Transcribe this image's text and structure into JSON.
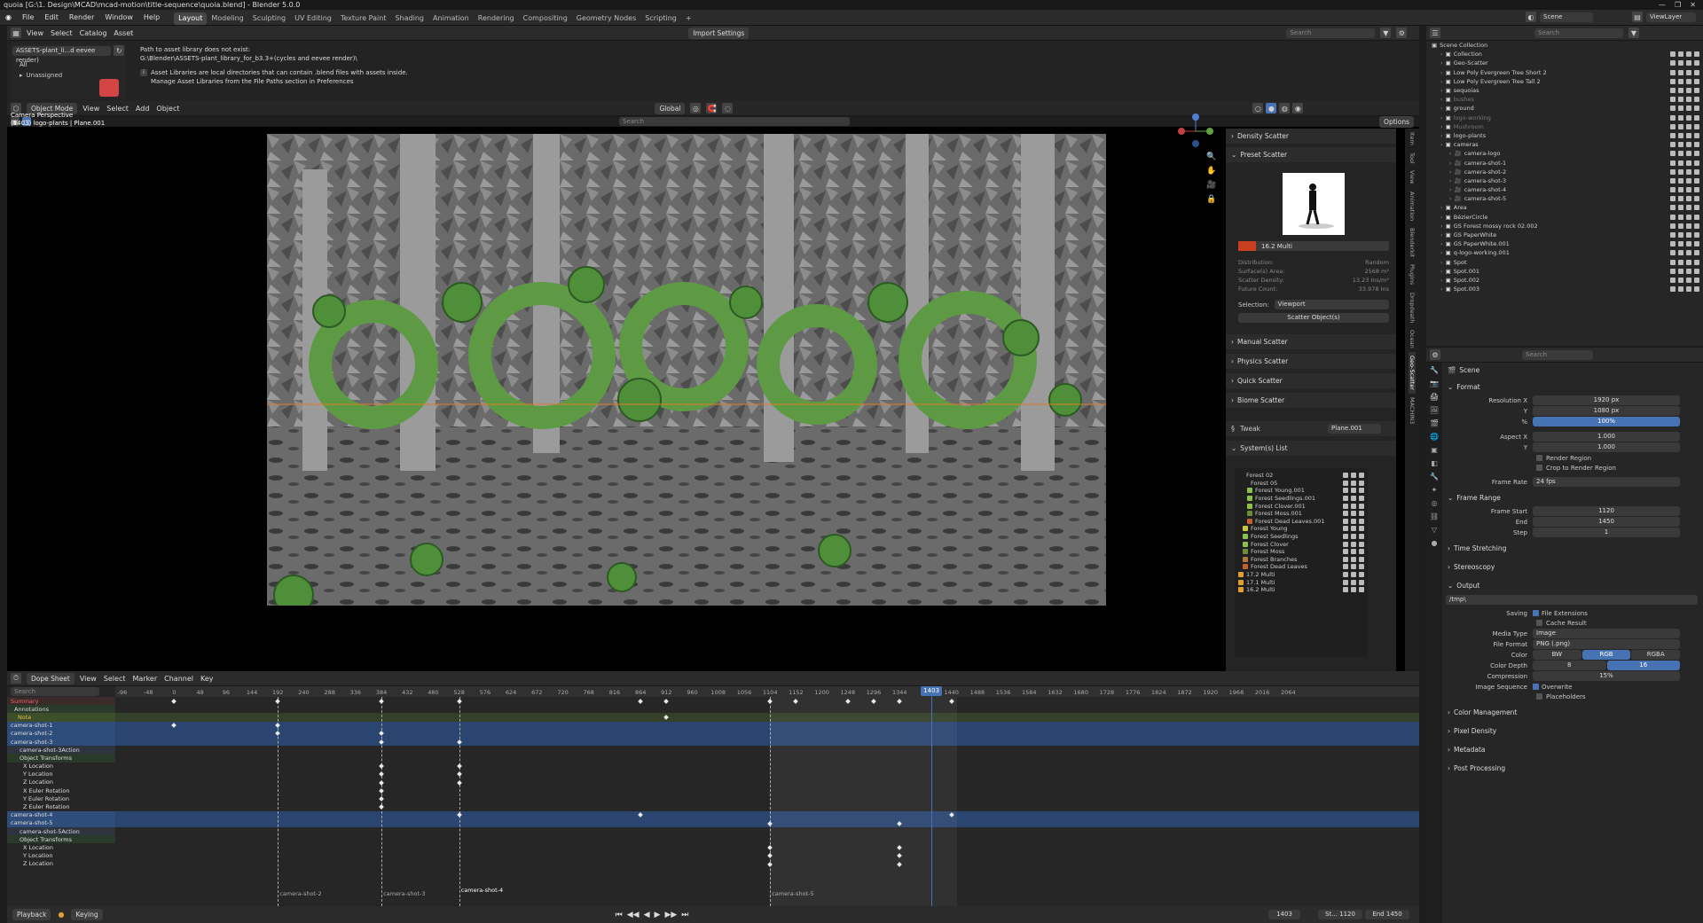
{
  "title_bar": "quoia [G:\\1. Design\\MCAD\\mcad-motion\\title-sequence\\quoia.blend] - Blender 5.0.0",
  "menu": [
    "File",
    "Edit",
    "Render",
    "Window",
    "Help"
  ],
  "workspaces": [
    "Layout",
    "Modeling",
    "Sculpting",
    "UV Editing",
    "Texture Paint",
    "Shading",
    "Animation",
    "Rendering",
    "Compositing",
    "Geometry Nodes",
    "Scripting",
    "+"
  ],
  "active_workspace": "Layout",
  "scene_label": "Scene",
  "viewlayer_label": "ViewLayer",
  "asset_browser": {
    "menus": [
      "View",
      "Select",
      "Catalog",
      "Asset"
    ],
    "import_label": "Import Settings",
    "search_placeholder": "Search",
    "library": "ASSETS-plant_li...d eevee render)",
    "cat_all": "All",
    "cat_unassigned": "Unassigned",
    "error_title": "Path to asset library does not exist:",
    "error_path": "G:\\Blender\\ASSETS-plant_library_for_b3.3+(cycles and eevee render)\\",
    "info_line1": "Asset Libraries are local directories that can contain .blend files with assets inside.",
    "info_line2": "Manage Asset Libraries from the File Paths section in Preferences"
  },
  "viewport": {
    "mode": "Object Mode",
    "menus": [
      "View",
      "Select",
      "Add",
      "Object"
    ],
    "orientation": "Global",
    "options": "Options",
    "search_placeholder": "Search",
    "overlay_title": "Camera Perspective",
    "overlay_sub": "(1403) logo-plants | Plane.001"
  },
  "geo_scatter": {
    "sections_top": [
      "Density Scatter",
      "Preset Scatter"
    ],
    "preset_name": "16.2 Multi",
    "stats": [
      {
        "k": "Distribution:",
        "v": "Random"
      },
      {
        "k": "Surface(s) Area:",
        "v": "2568 m²"
      },
      {
        "k": "Scatter Density:",
        "v": "13.23 Ins/m²"
      },
      {
        "k": "Future Count:",
        "v": "33,978 Ins"
      }
    ],
    "selection_label": "Selection:",
    "selection_value": "Viewport",
    "scatter_btn": "Scatter Object(s)",
    "sections": [
      "Manual Scatter",
      "Physics Scatter",
      "Quick Scatter",
      "Biome Scatter"
    ],
    "tweak": "Tweak",
    "tweak_obj": "Plane.001",
    "systems_label": "System(s) List",
    "systems": [
      {
        "name": "Forest 02",
        "color": "",
        "indent": 0
      },
      {
        "name": "Forest 05",
        "color": "",
        "indent": 1
      },
      {
        "name": "Forest Young.001",
        "color": "#8bc34a",
        "indent": 2
      },
      {
        "name": "Forest Seedlings.001",
        "color": "#8bc34a",
        "indent": 2
      },
      {
        "name": "Forest Clover.001",
        "color": "#8bc34a",
        "indent": 2
      },
      {
        "name": "Forest Moss.001",
        "color": "#6b8e3a",
        "indent": 2
      },
      {
        "name": "Forest Dead Leaves.001",
        "color": "#c0622c",
        "indent": 2
      },
      {
        "name": "Forest Young",
        "color": "#c6c93a",
        "indent": 1
      },
      {
        "name": "Forest Seedlings",
        "color": "#8bc34a",
        "indent": 1
      },
      {
        "name": "Forest Clover",
        "color": "#8bc34a",
        "indent": 1
      },
      {
        "name": "Forest Moss",
        "color": "#6b8e3a",
        "indent": 1
      },
      {
        "name": "Forest Branches",
        "color": "#b07a3a",
        "indent": 1
      },
      {
        "name": "Forest Dead Leaves",
        "color": "#c0622c",
        "indent": 1
      },
      {
        "name": "17.2 Multi",
        "color": "#e0a030",
        "indent": 0
      },
      {
        "name": "17.1 Multi",
        "color": "#e0a030",
        "indent": 0
      },
      {
        "name": "16.2 Multi",
        "color": "#e0a030",
        "indent": 0
      }
    ],
    "tabs": [
      "Item",
      "Tool",
      "View",
      "Animation",
      "Blenderkit",
      "Plugins",
      "Dropdeath",
      "Ocean",
      "Geo-Scatter",
      "MACHIN3"
    ]
  },
  "outliner": {
    "search_placeholder": "Search",
    "root": "Scene Collection",
    "items": [
      {
        "name": "Collection",
        "indent": 1,
        "dim": false
      },
      {
        "name": "Geo-Scatter",
        "indent": 1,
        "dim": false
      },
      {
        "name": "Low Poly Evergreen Tree Short 2",
        "indent": 1,
        "dim": false
      },
      {
        "name": "Low Poly Evergreen Tree Tall 2",
        "indent": 1,
        "dim": false
      },
      {
        "name": "sequoias",
        "indent": 1,
        "dim": false
      },
      {
        "name": "bushes",
        "indent": 1,
        "dim": true
      },
      {
        "name": "ground",
        "indent": 1,
        "dim": false
      },
      {
        "name": "logo-working",
        "indent": 1,
        "dim": true
      },
      {
        "name": "Mushroom",
        "indent": 1,
        "dim": true
      },
      {
        "name": "logo-plants",
        "indent": 1,
        "dim": false
      },
      {
        "name": "cameras",
        "indent": 1,
        "dim": false
      },
      {
        "name": "camera-logo",
        "indent": 2,
        "dim": false
      },
      {
        "name": "camera-shot-1",
        "indent": 2,
        "dim": false
      },
      {
        "name": "camera-shot-2",
        "indent": 2,
        "dim": false
      },
      {
        "name": "camera-shot-3",
        "indent": 2,
        "dim": false
      },
      {
        "name": "camera-shot-4",
        "indent": 2,
        "dim": false
      },
      {
        "name": "camera-shot-5",
        "indent": 2,
        "dim": false
      },
      {
        "name": "Area",
        "indent": 1,
        "dim": false
      },
      {
        "name": "BézierCircle",
        "indent": 1,
        "dim": false
      },
      {
        "name": "GS Forest mossy rock 02.002",
        "indent": 1,
        "dim": false
      },
      {
        "name": "GS PaperWhite",
        "indent": 1,
        "dim": false
      },
      {
        "name": "GS PaperWhite.001",
        "indent": 1,
        "dim": false
      },
      {
        "name": "q-logo-working.001",
        "indent": 1,
        "dim": false
      },
      {
        "name": "Spot",
        "indent": 1,
        "dim": false
      },
      {
        "name": "Spot.001",
        "indent": 1,
        "dim": false
      },
      {
        "name": "Spot.002",
        "indent": 1,
        "dim": false
      },
      {
        "name": "Spot.003",
        "indent": 1,
        "dim": false
      }
    ]
  },
  "properties": {
    "search_placeholder": "Search",
    "scene": "Scene",
    "format": "Format",
    "res_x_label": "Resolution X",
    "res_x": "1920 px",
    "res_y_label": "Y",
    "res_y": "1080 px",
    "pct_label": "%",
    "pct": "100%",
    "aspect_x_label": "Aspect X",
    "aspect_x": "1.000",
    "aspect_y_label": "Y",
    "aspect_y": "1.000",
    "render_region": "Render Region",
    "crop_region": "Crop to Render Region",
    "frame_rate_label": "Frame Rate",
    "frame_rate": "24 fps",
    "frame_range": "Frame Range",
    "frame_start_label": "Frame Start",
    "frame_start": "1120",
    "end_label": "End",
    "end": "1450",
    "step_label": "Step",
    "step": "1",
    "time_stretching": "Time Stretching",
    "stereoscopy": "Stereoscopy",
    "output": "Output",
    "output_path": "/tmp\\",
    "saving_label": "Saving",
    "file_ext": "File Extensions",
    "cache_result": "Cache Result",
    "media_type_label": "Media Type",
    "media_type": "Image",
    "file_format_label": "File Format",
    "file_format": "PNG (.png)",
    "color_label": "Color",
    "color_opts": [
      "BW",
      "RGB",
      "RGBA"
    ],
    "color_depth_label": "Color Depth",
    "color_depth_opts": [
      "8",
      "16"
    ],
    "compression_label": "Compression",
    "compression": "15%",
    "img_seq_label": "Image Sequence",
    "overwrite": "Overwrite",
    "placeholders": "Placeholders",
    "color_mgmt": "Color Management",
    "pixel_density": "Pixel Density",
    "metadata": "Metadata",
    "post_processing": "Post Processing"
  },
  "dopesheet": {
    "editor": "Dope Sheet",
    "menus": [
      "View",
      "Select",
      "Marker",
      "Channel",
      "Key"
    ],
    "search_placeholder": "Search",
    "current_frame": "1403",
    "ruler": [
      "-96",
      "-48",
      "0",
      "48",
      "96",
      "144",
      "192",
      "240",
      "288",
      "336",
      "384",
      "432",
      "480",
      "528",
      "576",
      "624",
      "672",
      "720",
      "768",
      "816",
      "864",
      "912",
      "960",
      "1008",
      "1056",
      "1104",
      "1152",
      "1200",
      "1248",
      "1296",
      "1344",
      "1403",
      "1440",
      "1488",
      "1536",
      "1584",
      "1632",
      "1680",
      "1728",
      "1776",
      "1824",
      "1872",
      "1920",
      "1968",
      "2016",
      "2064"
    ],
    "channels": [
      {
        "name": "Summary",
        "kind": "summary"
      },
      {
        "name": "Annotations",
        "kind": "group"
      },
      {
        "name": "Note",
        "kind": "note"
      },
      {
        "name": "camera-shot-1",
        "kind": "obj"
      },
      {
        "name": "camera-shot-2",
        "kind": "obj"
      },
      {
        "name": "camera-shot-3",
        "kind": "obj"
      },
      {
        "name": "camera-shot-3Action",
        "kind": "action"
      },
      {
        "name": "Object Transforms",
        "kind": "ot"
      },
      {
        "name": "X Location",
        "kind": "fc"
      },
      {
        "name": "Y Location",
        "kind": "fc"
      },
      {
        "name": "Z Location",
        "kind": "fc"
      },
      {
        "name": "X Euler Rotation",
        "kind": "fc"
      },
      {
        "name": "Y Euler Rotation",
        "kind": "fc"
      },
      {
        "name": "Z Euler Rotation",
        "kind": "fc"
      },
      {
        "name": "camera-shot-4",
        "kind": "obj"
      },
      {
        "name": "camera-shot-5",
        "kind": "obj"
      },
      {
        "name": "camera-shot-5Action",
        "kind": "action"
      },
      {
        "name": "Object Transforms",
        "kind": "ot"
      },
      {
        "name": "X Location",
        "kind": "fc"
      },
      {
        "name": "Y Location",
        "kind": "fc"
      },
      {
        "name": "Z Location",
        "kind": "fc"
      }
    ],
    "markers": [
      "camera-shot-2",
      "camera-shot-3",
      "camera-shot-4",
      "camera-shot-5"
    ],
    "playback": "Playback",
    "keying": "Keying",
    "frame": "1403",
    "start_label": "St...",
    "start": "1120",
    "end_label": "End",
    "end": "1450"
  },
  "colors": {
    "accent": "#4772b3",
    "obj_row": "#2f4d7a",
    "dark": "#1d1d1d"
  }
}
